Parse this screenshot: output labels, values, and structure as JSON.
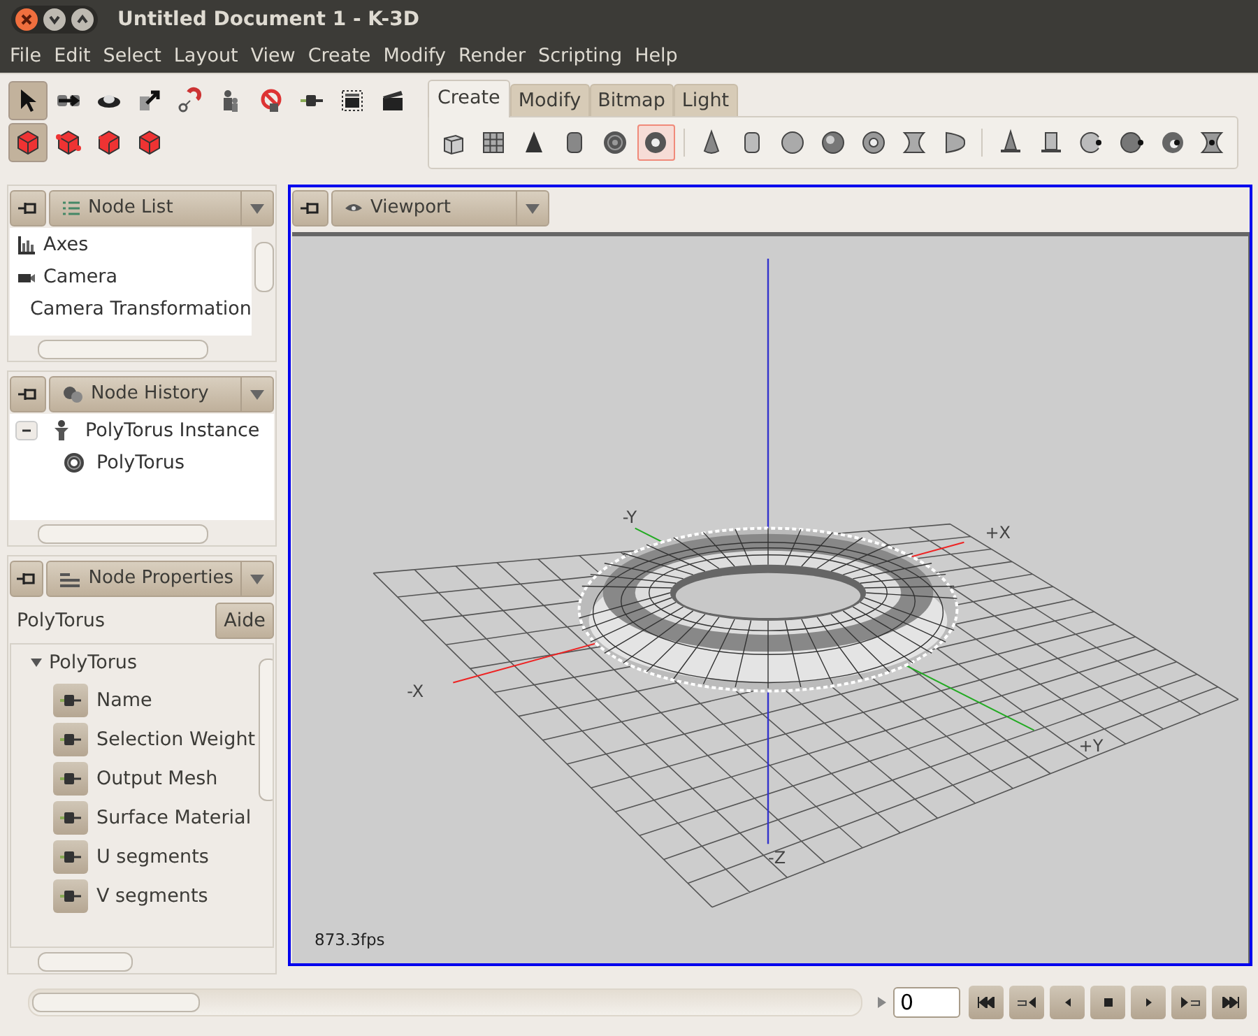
{
  "window": {
    "title": "Untitled Document 1 - K-3D"
  },
  "menu": [
    "File",
    "Edit",
    "Select",
    "Layout",
    "View",
    "Create",
    "Modify",
    "Render",
    "Scripting",
    "Help"
  ],
  "tools": {
    "row_1": [
      {
        "selected": true
      },
      {
        "selected": false
      },
      {
        "selected": false
      },
      {
        "selected": false
      },
      {
        "selected": false
      },
      {
        "selected": false
      },
      {
        "selected": false
      },
      {
        "selected": false
      },
      {
        "selected": false
      },
      {
        "selected": false
      }
    ],
    "row_2": [
      {
        "selected": true
      },
      {
        "selected": false
      },
      {
        "selected": false
      },
      {
        "selected": false
      }
    ]
  },
  "create_tabs": [
    {
      "label": "Create",
      "selected": true
    },
    {
      "label": "Modify",
      "selected": false
    },
    {
      "label": "Bitmap",
      "selected": false
    },
    {
      "label": "Light",
      "selected": false
    }
  ],
  "create_tool_groups": [
    [
      {
        "selected": false
      },
      {
        "selected": false
      },
      {
        "selected": false
      },
      {
        "selected": false
      },
      {
        "selected": false
      },
      {
        "selected": true
      }
    ],
    [
      {
        "selected": false
      },
      {
        "selected": false
      },
      {
        "selected": false
      },
      {
        "selected": false
      },
      {
        "selected": false
      },
      {
        "selected": false
      },
      {
        "selected": false
      }
    ],
    [
      {
        "selected": false
      },
      {
        "selected": false
      },
      {
        "selected": false
      },
      {
        "selected": false
      },
      {
        "selected": false
      },
      {
        "selected": false
      }
    ]
  ],
  "node_list": {
    "title": "Node List",
    "items": [
      {
        "label": "Axes"
      },
      {
        "label": "Camera"
      },
      {
        "label": "Camera Transformation"
      }
    ]
  },
  "node_history": {
    "title": "Node History",
    "items": [
      {
        "label": "PolyTorus Instance",
        "expanded": true,
        "children": [
          {
            "label": "PolyTorus"
          }
        ]
      }
    ]
  },
  "node_properties": {
    "title": "Node Properties",
    "node_name": "PolyTorus",
    "help_button": "Aide",
    "group": {
      "label": "PolyTorus",
      "expanded": true,
      "properties": [
        "Name",
        "Selection Weight",
        "Output Mesh",
        "Surface Material",
        "U segments",
        "V segments"
      ]
    }
  },
  "viewport": {
    "title": "Viewport",
    "axis_labels": {
      "plus_x": "+X",
      "minus_x": "-X",
      "plus_y": "+Y",
      "minus_y": "-Y",
      "minus_z": "-Z"
    },
    "fps": "873.3fps"
  },
  "timeline": {
    "frame": "0",
    "level": 0
  }
}
